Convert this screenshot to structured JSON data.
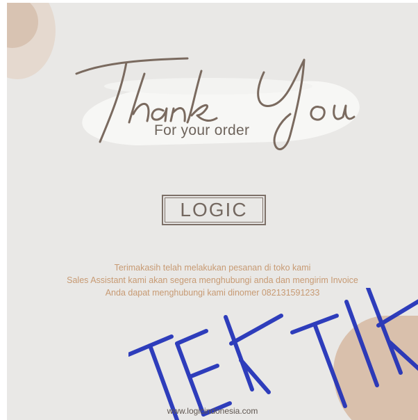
{
  "card": {
    "subtitle": "For your order",
    "brand": "LOGIC",
    "message_lines": [
      "Terimakasih telah melakukan pesanan di toko kami",
      "Sales Assistant kami akan segera menghubungi anda dan mengirim Invoice",
      "Anda dapat menghubungi kami dinomer 082131591233"
    ],
    "website": "www.logicindonesia.com",
    "headline_script": "Thank You"
  },
  "colors": {
    "background": "#e9e8e6",
    "brown_text": "#6e645c",
    "accent_text": "#c79a73",
    "watermark_blue": "#1f2fb8"
  }
}
